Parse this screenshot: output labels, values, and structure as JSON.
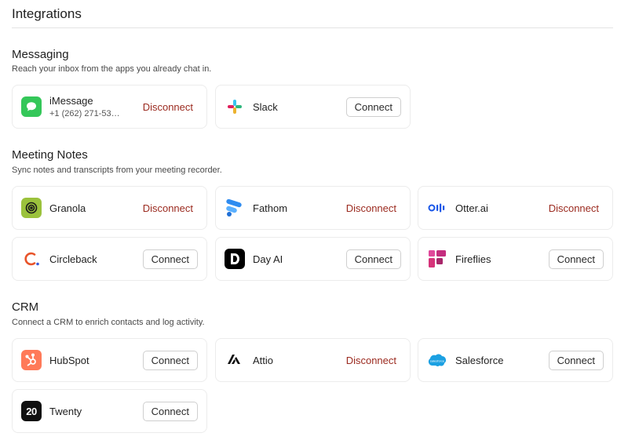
{
  "page": {
    "title": "Integrations"
  },
  "labels": {
    "connect": "Connect",
    "disconnect": "Disconnect"
  },
  "messaging": {
    "title": "Messaging",
    "description": "Reach your inbox from the apps you already chat in.",
    "items": [
      {
        "name": "iMessage",
        "detail": "+1 (262) 271-53…",
        "action": "Disconnect",
        "icon": "imessage-icon"
      },
      {
        "name": "Slack",
        "action": "Connect",
        "icon": "slack-icon"
      }
    ]
  },
  "meeting_notes": {
    "title": "Meeting Notes",
    "description": "Sync notes and transcripts from your meeting recorder.",
    "items": [
      {
        "name": "Granola",
        "action": "Disconnect",
        "icon": "granola-icon"
      },
      {
        "name": "Fathom",
        "action": "Disconnect",
        "icon": "fathom-icon"
      },
      {
        "name": "Otter.ai",
        "action": "Disconnect",
        "icon": "otter-icon"
      },
      {
        "name": "Circleback",
        "action": "Connect",
        "icon": "circleback-icon"
      },
      {
        "name": "Day AI",
        "action": "Connect",
        "icon": "dayai-icon"
      },
      {
        "name": "Fireflies",
        "action": "Connect",
        "icon": "fireflies-icon"
      }
    ]
  },
  "crm": {
    "title": "CRM",
    "description": "Connect a CRM to enrich contacts and log activity.",
    "items": [
      {
        "name": "HubSpot",
        "action": "Connect",
        "icon": "hubspot-icon"
      },
      {
        "name": "Attio",
        "action": "Disconnect",
        "icon": "attio-icon"
      },
      {
        "name": "Salesforce",
        "action": "Connect",
        "icon": "salesforce-icon",
        "logo_text": "salesforce"
      },
      {
        "name": "Twenty",
        "action": "Connect",
        "icon": "twenty-icon",
        "logo_text": "20"
      }
    ]
  },
  "colors": {
    "disconnect": "#9b2a1f",
    "imessage": "#34c759",
    "granola": "#9bc23c",
    "fathom": "#2f8cf0",
    "otter": "#1a57e8",
    "circleback": "#e8542a",
    "hubspot": "#ff7a59",
    "salesforce": "#1ba0e2",
    "fireflies": "#d6337a"
  }
}
